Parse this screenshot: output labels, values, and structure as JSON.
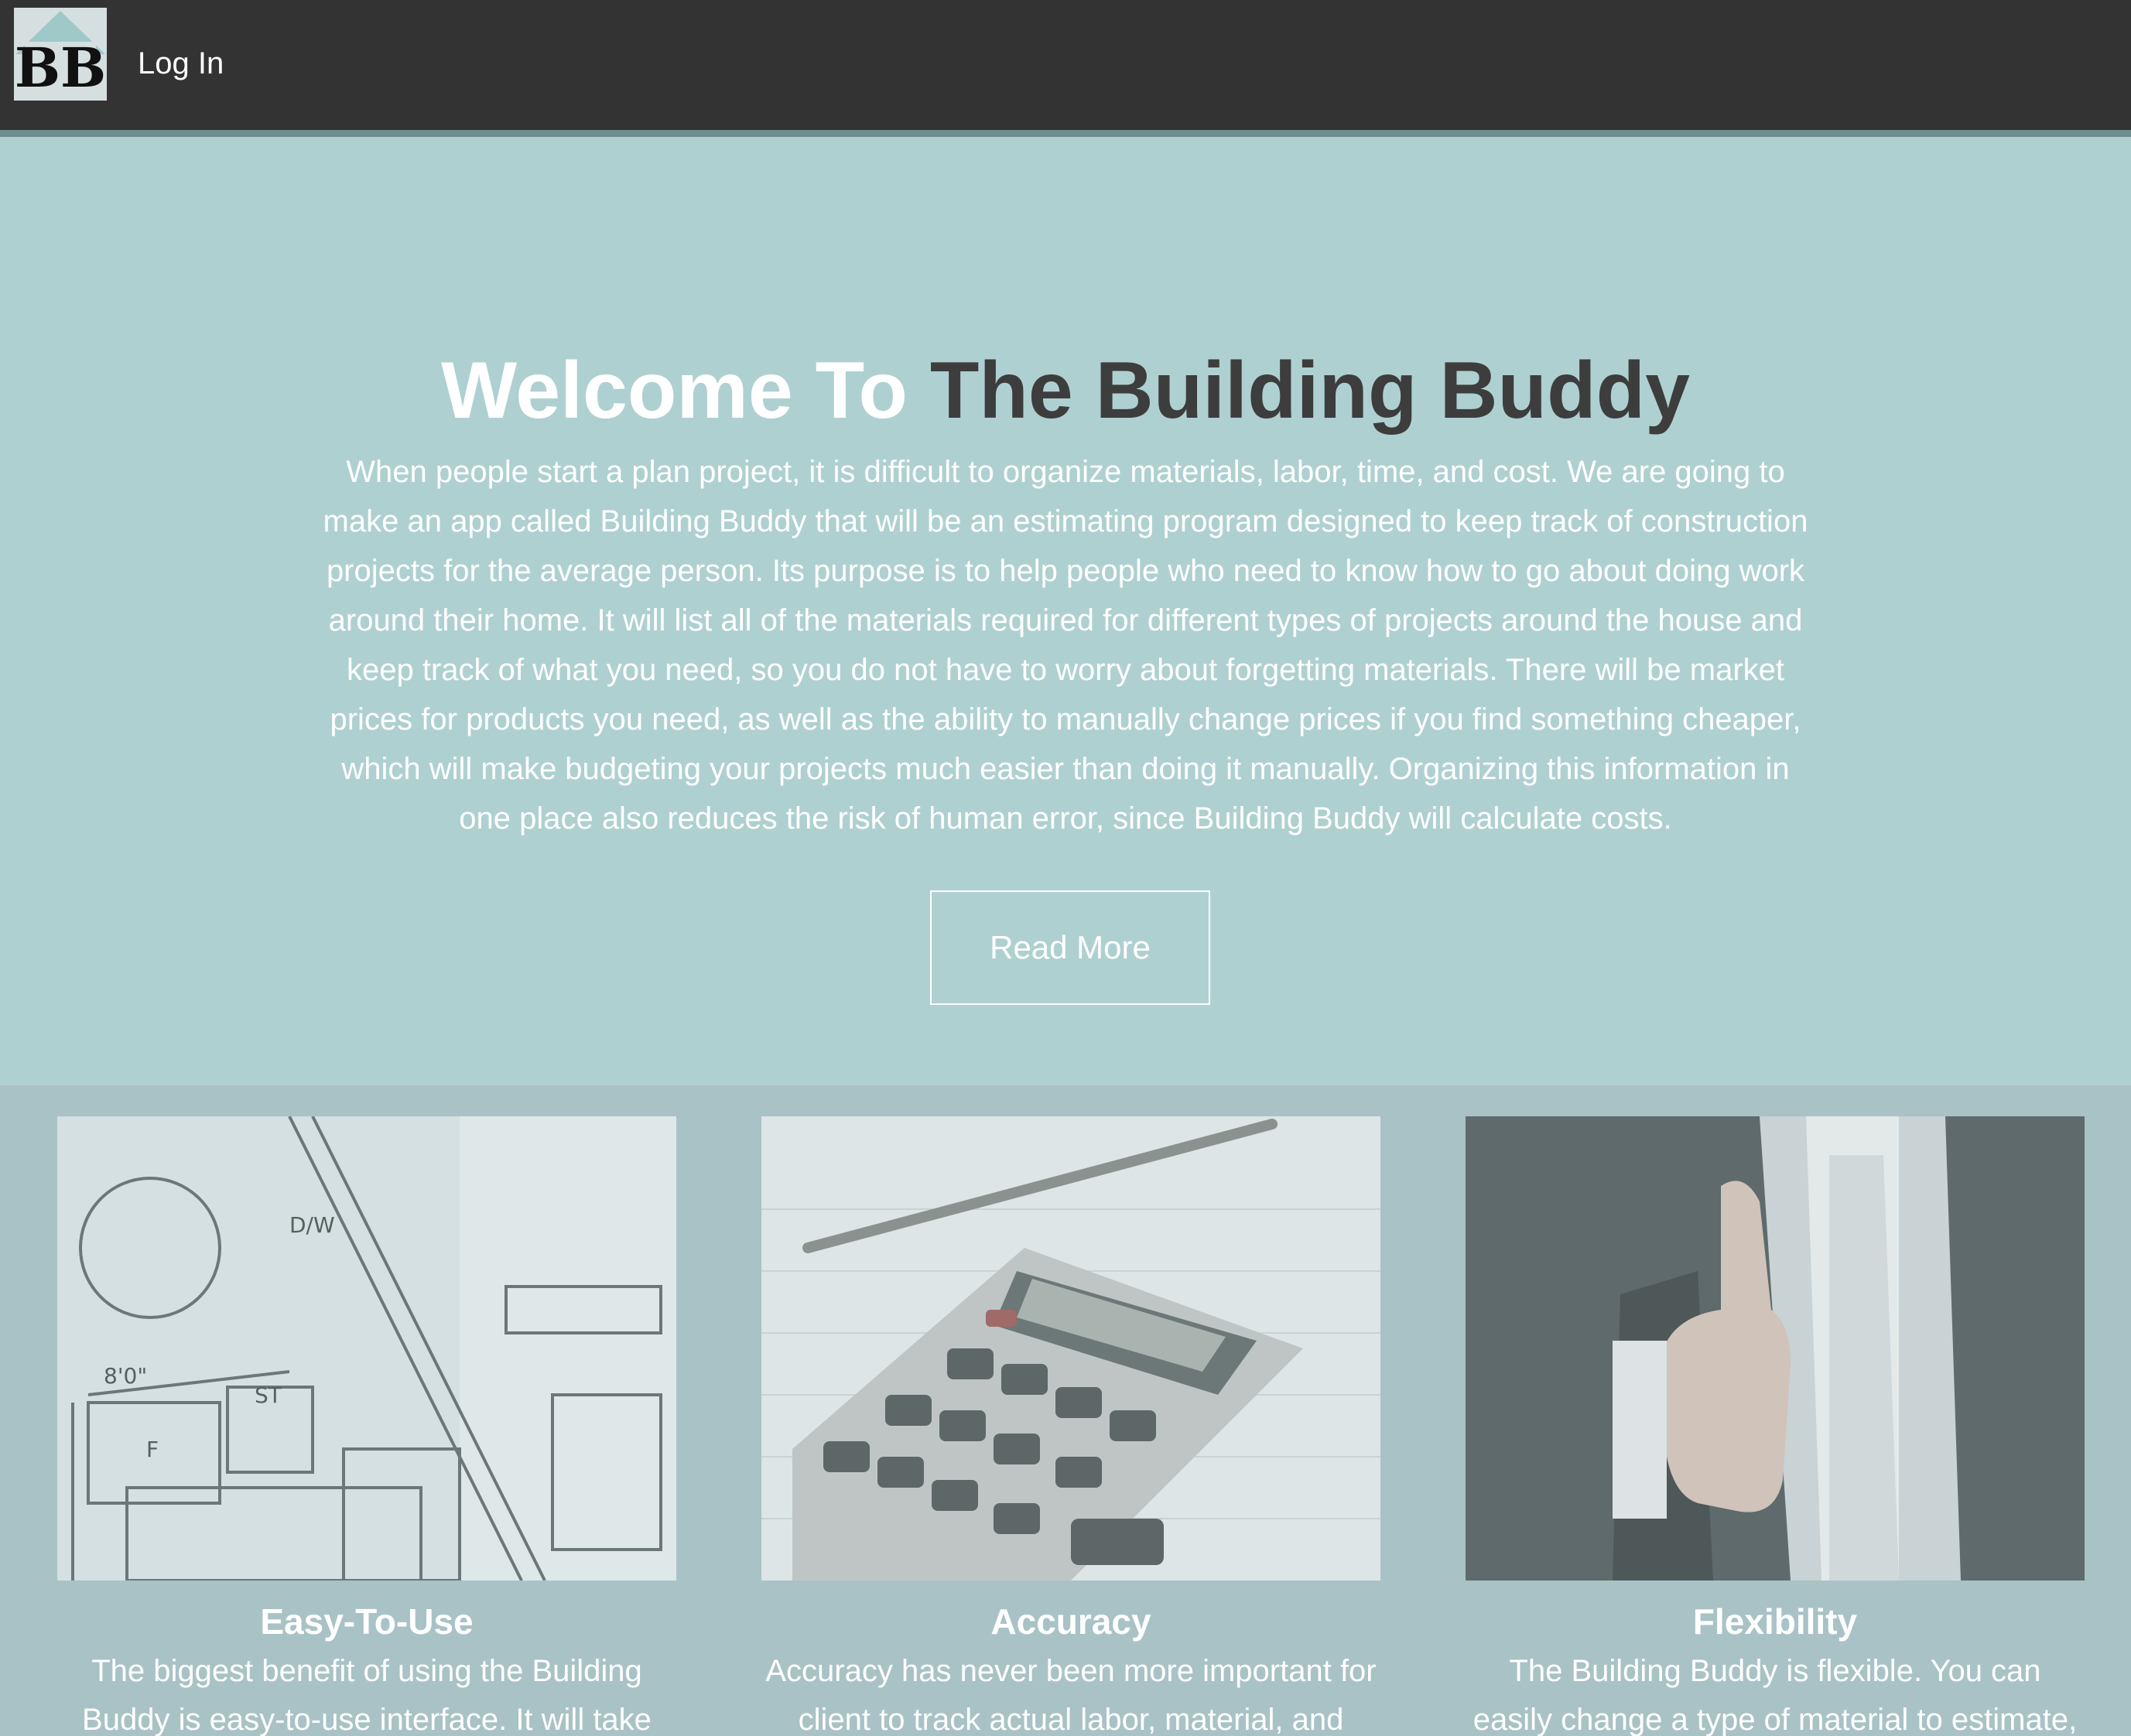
{
  "nav": {
    "logo_alt": "BB",
    "login_label": "Log In"
  },
  "hero": {
    "title_white": "Welcome To",
    "title_dark": "The Building Buddy",
    "description": "When people start a plan project, it is difficult to organize materials, labor, time, and cost. We are going to make an app called Building Buddy that will be an estimating program designed to keep track of construction projects for the average person. Its purpose is to help people who need to know how to go about doing work around their home. It will list all of the materials required for different types of projects around the house and keep track of what you need, so you do not have to worry about forgetting materials. There will be market prices for products you need, as well as the ability to manually change prices if you find something cheaper, which will make budgeting your projects much easier than doing it manually. Organizing this information in one place also reduces the risk of human error, since Building Buddy will calculate costs.",
    "button_label": "Read More"
  },
  "features": [
    {
      "title": "Easy-To-Use",
      "text": "The biggest benefit of using the Building Buddy is easy-to-use interface. It will take less time to",
      "image": "blueprint-floor-plan"
    },
    {
      "title": "Accuracy",
      "text": "Accuracy has never been more important for client to track actual labor, material, and",
      "image": "calculator-and-pen"
    },
    {
      "title": "Flexibility",
      "text": "The Building Buddy is flexible. You can easily change a type of material to estimate, adjust",
      "image": "businessman-thumbs-up"
    }
  ],
  "colors": {
    "topbar": "#333333",
    "hero_bg": "#afd0d1",
    "features_bg": "#a9c2c6",
    "title_dark": "#3d3d3d"
  }
}
